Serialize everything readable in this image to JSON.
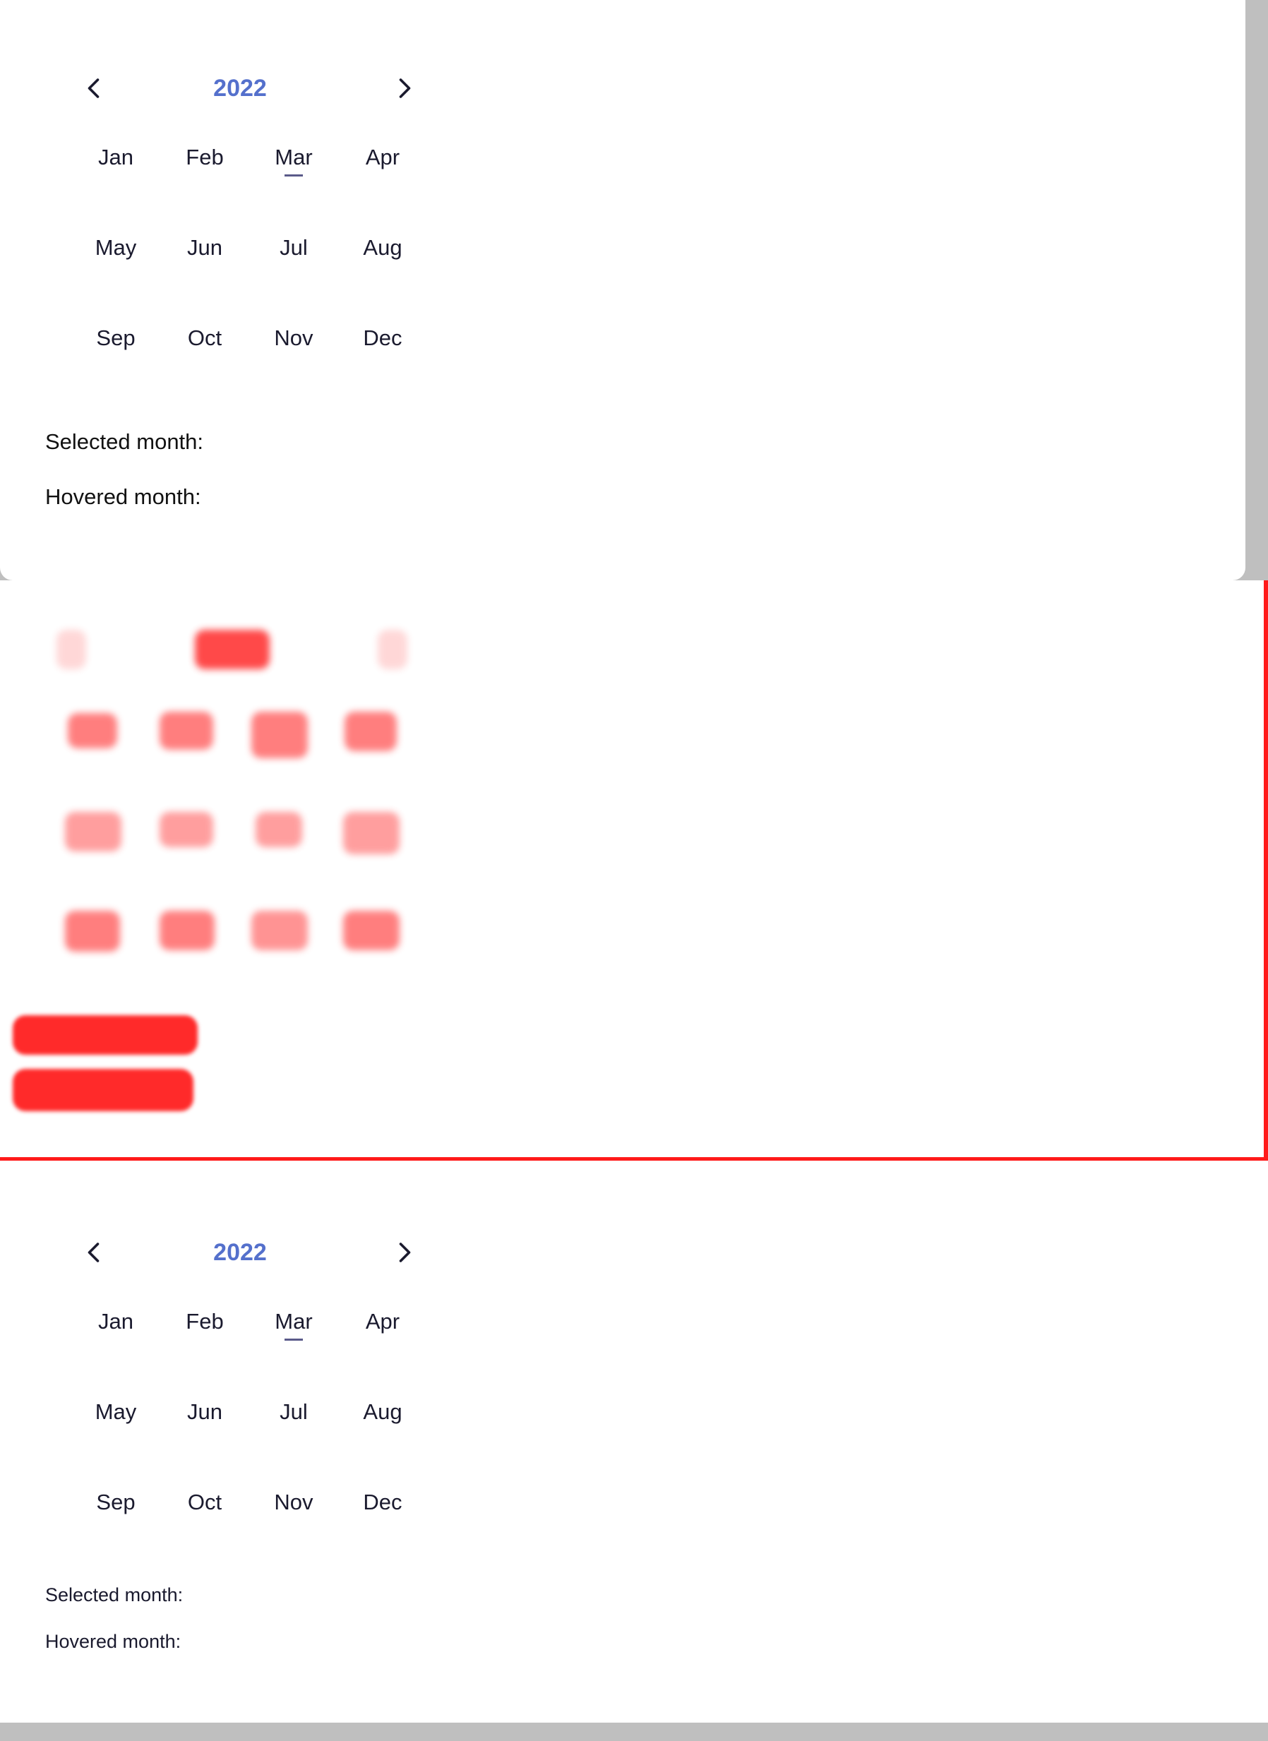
{
  "calendar_top": {
    "year": "2022",
    "months": [
      "Jan",
      "Feb",
      "Mar",
      "Apr",
      "May",
      "Jun",
      "Jul",
      "Aug",
      "Sep",
      "Oct",
      "Nov",
      "Dec"
    ],
    "selected_label": "Selected month:",
    "hovered_label": "Hovered month:"
  },
  "calendar_bottom": {
    "year": "2022",
    "months": [
      "Jan",
      "Feb",
      "Mar",
      "Apr",
      "May",
      "Jun",
      "Jul",
      "Aug",
      "Sep",
      "Oct",
      "Nov",
      "Dec"
    ],
    "selected_label": "Selected month:",
    "hovered_label": "Hovered month:"
  },
  "colors": {
    "accent": "#5470cc",
    "highlight_red": "#ff1a1a",
    "page_bg": "#bfbfbf"
  }
}
